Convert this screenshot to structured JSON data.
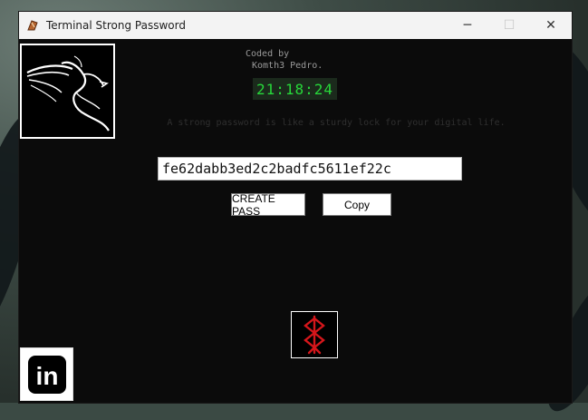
{
  "window": {
    "title": "Terminal Strong Password",
    "controls": {
      "minimize": "─",
      "maximize": "☐",
      "close": "✕"
    }
  },
  "credits": {
    "line1": "Coded by",
    "line2": "Komth3 Pedro."
  },
  "clock": "21:18:24",
  "tagline": "A strong password is like a sturdy lock for your digital life.",
  "password": {
    "value": "fe62dabb3ed2c2badfc5611ef22c"
  },
  "buttons": {
    "create": "CREATE PASS",
    "copy": "Copy"
  },
  "linkedin": {
    "text": "in"
  },
  "colors": {
    "background": "#0b0b0b",
    "clock_text": "#27d83a",
    "clock_bg": "#1b2a1c",
    "symbol": "#d4161b"
  },
  "icons": {
    "app": "app-icon",
    "logo": "dragon-logo-icon",
    "symbol": "brand-of-sacrifice-icon",
    "social": "linkedin-icon"
  }
}
